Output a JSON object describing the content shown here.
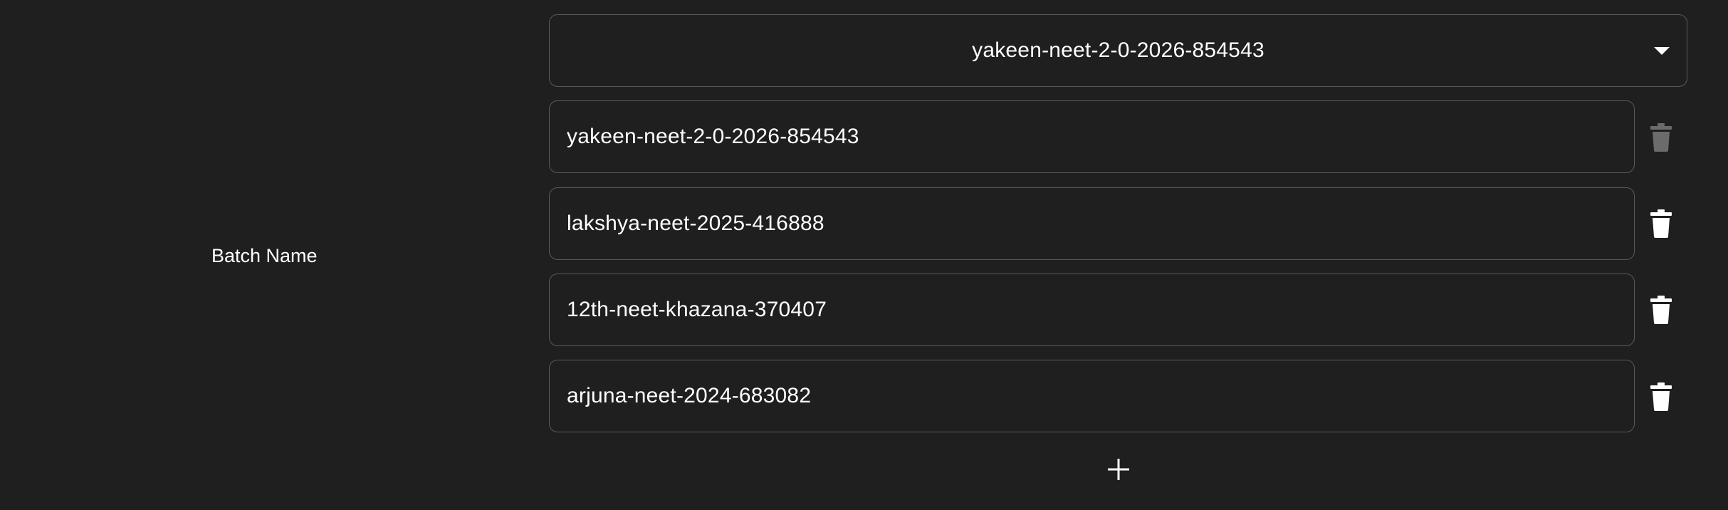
{
  "form": {
    "field_label": "Batch Name",
    "select": {
      "selected_value": "yakeen-neet-2-0-2026-854543",
      "caret_icon": "caret-down-icon"
    },
    "batches": [
      {
        "value": "yakeen-neet-2-0-2026-854543",
        "delete_enabled": false
      },
      {
        "value": "lakshya-neet-2025-416888",
        "delete_enabled": true
      },
      {
        "value": "12th-neet-khazana-370407",
        "delete_enabled": true
      },
      {
        "value": "arjuna-neet-2024-683082",
        "delete_enabled": true
      }
    ],
    "add_icon": "plus-icon",
    "delete_icon": "trash-icon"
  },
  "colors": {
    "background": "#1f1f1f",
    "border": "#5a5a5a",
    "text": "#ffffff",
    "icon_enabled": "#ffffff",
    "icon_disabled": "#6b6b6b"
  }
}
